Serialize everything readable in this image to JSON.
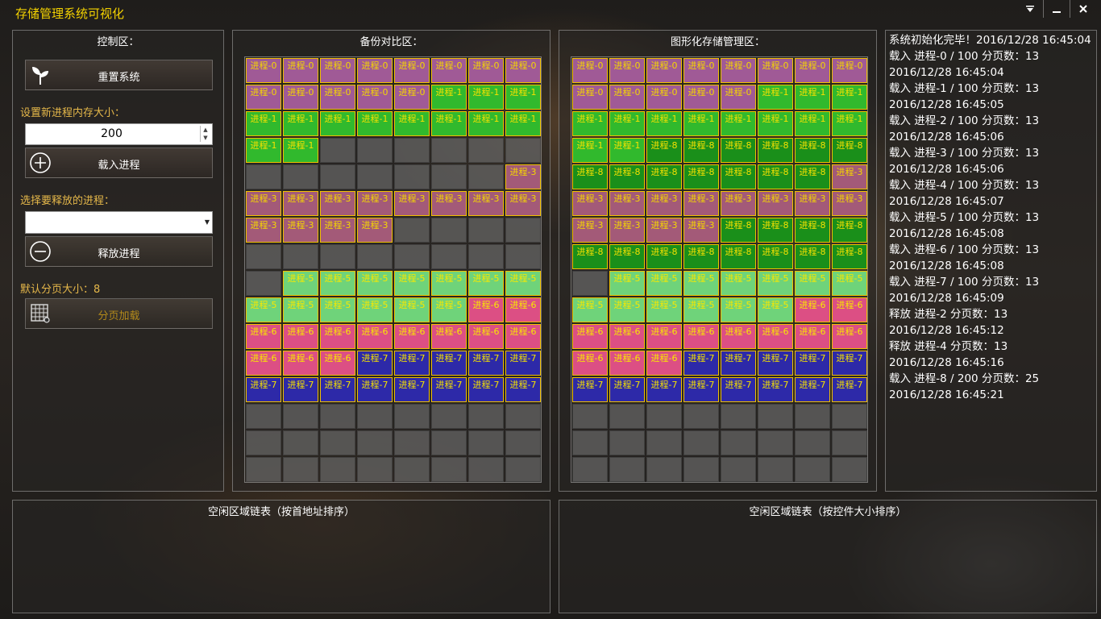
{
  "app": {
    "title": "存储管理系统可视化"
  },
  "window_controls": [
    "menu-icon",
    "minimize-icon",
    "close-icon"
  ],
  "control": {
    "title": "控制区：",
    "reset_label": "重置系统",
    "mem_size_label": "设置新进程内存大小：",
    "mem_size_value": "200",
    "load_label": "载入进程",
    "release_select_label": "选择要释放的进程：",
    "release_select_value": "",
    "release_label": "释放进程",
    "page_size_label": "默认分页大小：8",
    "page_button_label": "分页加载"
  },
  "backup": {
    "title": "备份对比区：",
    "cells": [
      "进程-0",
      "进程-0",
      "进程-0",
      "进程-0",
      "进程-0",
      "进程-0",
      "进程-0",
      "进程-0",
      "进程-0",
      "进程-0",
      "进程-0",
      "进程-0",
      "进程-0",
      "进程-1",
      "进程-1",
      "进程-1",
      "进程-1",
      "进程-1",
      "进程-1",
      "进程-1",
      "进程-1",
      "进程-1",
      "进程-1",
      "进程-1",
      "进程-1",
      "进程-1",
      "",
      "",
      "",
      "",
      "",
      "",
      "",
      "",
      "",
      "",
      "",
      "",
      "",
      "进程-3",
      "进程-3",
      "进程-3",
      "进程-3",
      "进程-3",
      "进程-3",
      "进程-3",
      "进程-3",
      "进程-3",
      "进程-3",
      "进程-3",
      "进程-3",
      "进程-3",
      "",
      "",
      "",
      "",
      "",
      "",
      "",
      "",
      "",
      "",
      "",
      "",
      "",
      "进程-5",
      "进程-5",
      "进程-5",
      "进程-5",
      "进程-5",
      "进程-5",
      "进程-5",
      "进程-5",
      "进程-5",
      "进程-5",
      "进程-5",
      "进程-5",
      "进程-5",
      "进程-6",
      "进程-6",
      "进程-6",
      "进程-6",
      "进程-6",
      "进程-6",
      "进程-6",
      "进程-6",
      "进程-6",
      "进程-6",
      "进程-6",
      "进程-6",
      "进程-6",
      "进程-7",
      "进程-7",
      "进程-7",
      "进程-7",
      "进程-7",
      "进程-7",
      "进程-7",
      "进程-7",
      "进程-7",
      "进程-7",
      "进程-7",
      "进程-7",
      "进程-7",
      "",
      "",
      "",
      "",
      "",
      "",
      "",
      "",
      "",
      "",
      "",
      "",
      "",
      "",
      "",
      "",
      "",
      "",
      "",
      "",
      "",
      "",
      "",
      ""
    ]
  },
  "graphic": {
    "title": "图形化存储管理区：",
    "cells": [
      "进程-0",
      "进程-0",
      "进程-0",
      "进程-0",
      "进程-0",
      "进程-0",
      "进程-0",
      "进程-0",
      "进程-0",
      "进程-0",
      "进程-0",
      "进程-0",
      "进程-0",
      "进程-1",
      "进程-1",
      "进程-1",
      "进程-1",
      "进程-1",
      "进程-1",
      "进程-1",
      "进程-1",
      "进程-1",
      "进程-1",
      "进程-1",
      "进程-1",
      "进程-1",
      "进程-8",
      "进程-8",
      "进程-8",
      "进程-8",
      "进程-8",
      "进程-8",
      "进程-8",
      "进程-8",
      "进程-8",
      "进程-8",
      "进程-8",
      "进程-8",
      "进程-8",
      "进程-3",
      "进程-3",
      "进程-3",
      "进程-3",
      "进程-3",
      "进程-3",
      "进程-3",
      "进程-3",
      "进程-3",
      "进程-3",
      "进程-3",
      "进程-3",
      "进程-3",
      "进程-8",
      "进程-8",
      "进程-8",
      "进程-8",
      "进程-8",
      "进程-8",
      "进程-8",
      "进程-8",
      "进程-8",
      "进程-8",
      "进程-8",
      "进程-8",
      "",
      "进程-5",
      "进程-5",
      "进程-5",
      "进程-5",
      "进程-5",
      "进程-5",
      "进程-5",
      "进程-5",
      "进程-5",
      "进程-5",
      "进程-5",
      "进程-5",
      "进程-5",
      "进程-6",
      "进程-6",
      "进程-6",
      "进程-6",
      "进程-6",
      "进程-6",
      "进程-6",
      "进程-6",
      "进程-6",
      "进程-6",
      "进程-6",
      "进程-6",
      "进程-6",
      "进程-7",
      "进程-7",
      "进程-7",
      "进程-7",
      "进程-7",
      "进程-7",
      "进程-7",
      "进程-7",
      "进程-7",
      "进程-7",
      "进程-7",
      "进程-7",
      "进程-7",
      "",
      "",
      "",
      "",
      "",
      "",
      "",
      "",
      "",
      "",
      "",
      "",
      "",
      "",
      "",
      "",
      "",
      "",
      "",
      "",
      "",
      "",
      "",
      ""
    ]
  },
  "log": {
    "lines": [
      "系统初始化完毕！2016/12/28 16:45:04",
      "载入 进程-0 / 100   分页数：13",
      "2016/12/28 16:45:04",
      "载入 进程-1 / 100   分页数：13",
      "2016/12/28 16:45:05",
      "载入 进程-2 / 100   分页数：13",
      "2016/12/28 16:45:06",
      "载入 进程-3 / 100   分页数：13",
      "2016/12/28 16:45:06",
      "载入 进程-4 / 100   分页数：13",
      "2016/12/28 16:45:07",
      "载入 进程-5 / 100   分页数：13",
      "2016/12/28 16:45:08",
      "载入 进程-6 / 100   分页数：13",
      "2016/12/28 16:45:08",
      "载入 进程-7 / 100   分页数：13",
      "2016/12/28 16:45:09",
      "释放 进程-2   分页数：13",
      "2016/12/28 16:45:12",
      "释放 进程-4   分页数：13",
      "2016/12/28 16:45:16",
      "载入 进程-8 / 200   分页数：25",
      "2016/12/28 16:45:21"
    ]
  },
  "free_by_address": {
    "title": "空闲区域链表（按首地址排序）"
  },
  "free_by_size": {
    "title": "空闲区域链表（按控件大小排序）"
  }
}
